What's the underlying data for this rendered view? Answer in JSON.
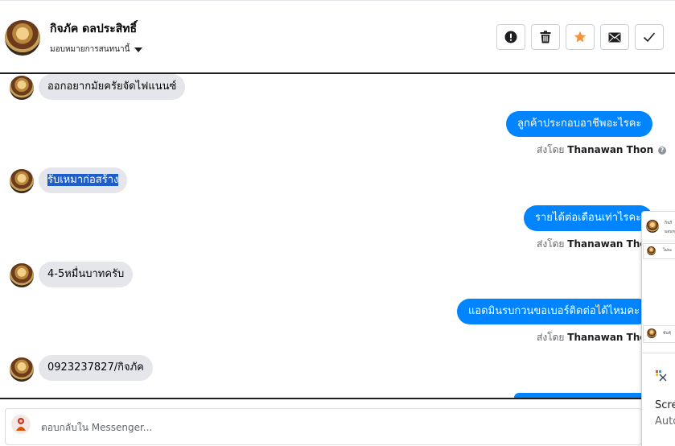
{
  "header": {
    "contact_name": "กิจภัค ดลประสิทธิ์",
    "assign_label": "มอบหมายการสนทนานี้",
    "actions": [
      {
        "name": "spam",
        "icon": "exclamation-icon"
      },
      {
        "name": "delete",
        "icon": "trash-icon"
      },
      {
        "name": "star",
        "icon": "star-icon",
        "color": "#f7923b"
      },
      {
        "name": "mail",
        "icon": "envelope-icon"
      },
      {
        "name": "done",
        "icon": "check-icon"
      }
    ]
  },
  "messages": [
    {
      "dir": "in",
      "text": "ออกอยากมัยครัยจัดไฟแนนซ์"
    },
    {
      "dir": "out",
      "text": "ลูกค้าประกอบอาชีพอะไรคะ",
      "sender_prefix": "ส่งโดย",
      "sender": "Thanawan Thon"
    },
    {
      "dir": "in",
      "text": "รับเหมาก่อสร้าง"
    },
    {
      "dir": "out",
      "text": "รายได้ต่อเดือนเท่าไรคะ",
      "sender_prefix": "ส่งโดย",
      "sender": "Thanawan Thon"
    },
    {
      "dir": "in",
      "text": "4-5หมื่นบาทครับ"
    },
    {
      "dir": "out",
      "text": "แอดมินรบกวนขอเบอร์ติดต่อได้ไหมคะ",
      "sender_prefix": "ส่งโดย",
      "sender": "Thanawan Thon"
    },
    {
      "dir": "in",
      "text": "0923237827/กิจภัค"
    }
  ],
  "reply": {
    "placeholder": "ตอบกลับใน Messenger..."
  },
  "overlay": {
    "card_name": "กิจภั",
    "card_sub": "มอบห",
    "row1_text": "ไม่จะ",
    "row2_text": "ขับคุ้",
    "snip_title": "Scre",
    "snip_sub": "Auto"
  },
  "colors": {
    "outgoing_bubble": "#0084ff",
    "incoming_bubble": "#e4e6eb",
    "star_accent": "#f7923b"
  }
}
